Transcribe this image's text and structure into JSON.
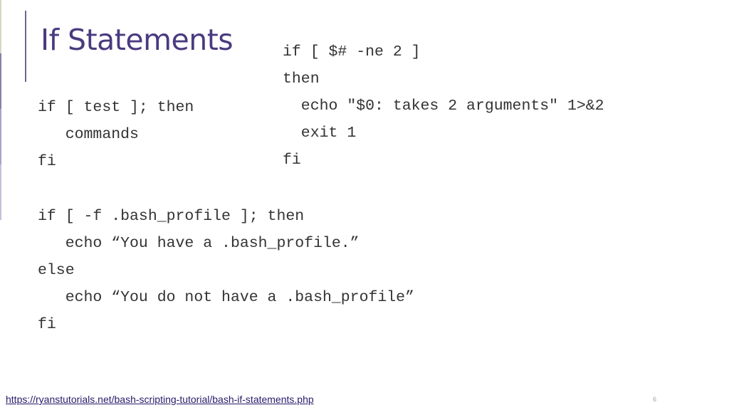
{
  "slide": {
    "title": "If Statements",
    "page_number": "6",
    "accent_color": "#4a3a80"
  },
  "code_right": {
    "lines": [
      "if [ $# -ne 2 ]",
      "then",
      "  echo \"$0: takes 2 arguments\" 1>&2",
      "  exit 1",
      "fi"
    ]
  },
  "code_left_1": {
    "lines": [
      "if [ test ]; then",
      "   commands",
      "fi"
    ]
  },
  "code_left_2": {
    "lines": [
      "if [ -f .bash_profile ]; then",
      "   echo “You have a .bash_profile.”",
      "else",
      "   echo “You do not have a .bash_profile”",
      "fi"
    ]
  },
  "footer": {
    "source_link": "https://ryanstutorials.net/bash-scripting-tutorial/bash-if-statements.php"
  }
}
